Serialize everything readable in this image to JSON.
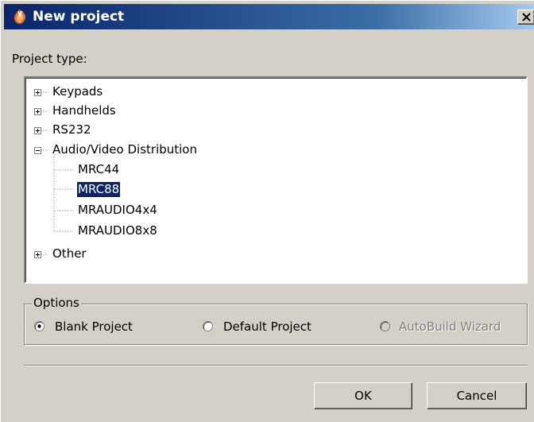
{
  "window": {
    "title": "New project",
    "close_glyph": "✕"
  },
  "project_type_label": "Project type:",
  "tree": {
    "nodes": [
      {
        "label": "Keypads",
        "expander": "plus"
      },
      {
        "label": "Handhelds",
        "expander": "plus"
      },
      {
        "label": "RS232",
        "expander": "plus"
      },
      {
        "label": "Audio/Video Distribution",
        "expander": "minus"
      },
      {
        "label": "MRC44"
      },
      {
        "label": "MRC88",
        "selected": true
      },
      {
        "label": "MRAUDIO4x4"
      },
      {
        "label": "MRAUDIO8x8"
      },
      {
        "label": "Other",
        "expander": "plus"
      }
    ]
  },
  "options": {
    "label": "Options",
    "radios": [
      {
        "label": "Blank Project",
        "checked": true,
        "enabled": true
      },
      {
        "label": "Default Project",
        "checked": false,
        "enabled": true
      },
      {
        "label": "AutoBuild Wizard",
        "checked": false,
        "enabled": false
      }
    ]
  },
  "buttons": {
    "ok": "OK",
    "cancel": "Cancel"
  },
  "colors": {
    "titlebar_start": "#0a246a",
    "titlebar_end": "#a6caf0",
    "selection": "#0a246a",
    "face": "#d4d0c8"
  }
}
